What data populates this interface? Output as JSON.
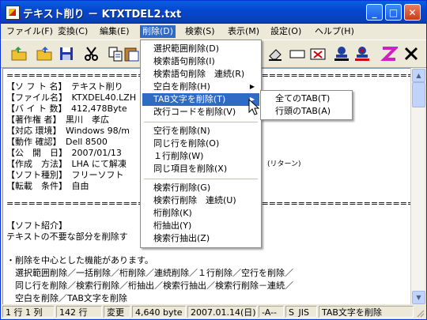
{
  "window": {
    "title": "テキスト削り － KTXTDEL2.txt"
  },
  "title_buttons": {
    "minimize": "_",
    "maximize": "□",
    "close": "✕"
  },
  "menubar": [
    "ファイル(F)",
    "変換(C)",
    "編集(E)",
    "削除(D)",
    "検索(S)",
    "表示(M)",
    "設定(O)",
    "ヘルプ(H)"
  ],
  "toolbar": {
    "icons": [
      "open-folder-icon",
      "open-folder-icon",
      "save-icon",
      "cut-icon",
      "copy-icon",
      "paste-icon",
      "eraser-icon",
      "rectangle-icon",
      "delete-rect-icon",
      "stamp-icon",
      "stamp-red-icon",
      "z-icon",
      "close-x-icon"
    ]
  },
  "editor_lines": [
    "========================================================",
    "【ソ フ ト 名】　テキスト削り",
    "【ファイル名】　KTXDEL40.LZH",
    "【バ イ ト 数】　412,478Byte",
    "【著作権 者】　黒川　孝広",
    "【対応 環境】　Windows 98/m",
    "【動作 確認】　Dell 8500",
    "【公　開　日】　2007/01/13",
    "【作成　方法】　LHA にて解凍",
    "【ソフト種別】　フリーソフト",
    "【転載　条件】　自由",
    "========================================================",
    "【ソフト紹介】",
    "テキストの不要な部分を削除す",
    "",
    "・削除を中心とした機能があります。",
    "　選択範囲削除／一括削除／桁削除／連続削除／１行削除／空行を削除／",
    "　同じ行を削除／検索行削除／桁抽出／検索行抽出／検索行削除－連続／",
    "　空白を削除／TAB文字を削除"
  ],
  "editor_extra": {
    "line8_suffix": "(リターン)"
  },
  "dropdown": {
    "items": [
      {
        "label": "選択範囲削除(D)"
      },
      {
        "label": "検索語句削除(I)"
      },
      {
        "label": "検索語句削除　連続(R)"
      },
      {
        "label": "空白を削除(H)",
        "submenu": true
      },
      {
        "label": "TAB文字を削除(T)",
        "submenu": true,
        "highlighted": true
      },
      {
        "label": "改行コードを削除(V)"
      },
      {
        "separator": true
      },
      {
        "label": "空行を削除(N)"
      },
      {
        "label": "同じ行を削除(O)"
      },
      {
        "label": "１行削除(W)"
      },
      {
        "label": "同じ項目を削除(X)"
      },
      {
        "separator": true
      },
      {
        "label": "検索行削除(G)"
      },
      {
        "label": "検索行削除　連続(U)"
      },
      {
        "label": "桁削除(K)"
      },
      {
        "label": "桁抽出(Y)"
      },
      {
        "label": "検索行抽出(Z)"
      }
    ]
  },
  "submenu": {
    "items": [
      "全てのTAB(T)",
      "行頭のTAB(A)"
    ]
  },
  "statusbar": {
    "position": "1 行 1 列",
    "lines": "142 行",
    "modified": "変更",
    "size": "4,640 byte",
    "date": "2007.01.14(日)",
    "mode": "-A--",
    "encoding": "S_JIS",
    "message": "TAB文字を削除"
  },
  "colors": {
    "highlight": "#316ac5",
    "titlebar": "#0548d0"
  }
}
